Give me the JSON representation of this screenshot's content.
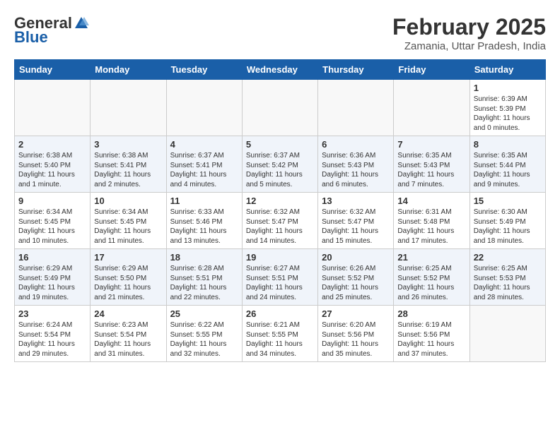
{
  "header": {
    "logo_general": "General",
    "logo_blue": "Blue",
    "title": "February 2025",
    "subtitle": "Zamania, Uttar Pradesh, India"
  },
  "days_of_week": [
    "Sunday",
    "Monday",
    "Tuesday",
    "Wednesday",
    "Thursday",
    "Friday",
    "Saturday"
  ],
  "weeks": [
    [
      {
        "day": "",
        "info": ""
      },
      {
        "day": "",
        "info": ""
      },
      {
        "day": "",
        "info": ""
      },
      {
        "day": "",
        "info": ""
      },
      {
        "day": "",
        "info": ""
      },
      {
        "day": "",
        "info": ""
      },
      {
        "day": "1",
        "info": "Sunrise: 6:39 AM\nSunset: 5:39 PM\nDaylight: 11 hours\nand 0 minutes."
      }
    ],
    [
      {
        "day": "2",
        "info": "Sunrise: 6:38 AM\nSunset: 5:40 PM\nDaylight: 11 hours\nand 1 minute."
      },
      {
        "day": "3",
        "info": "Sunrise: 6:38 AM\nSunset: 5:41 PM\nDaylight: 11 hours\nand 2 minutes."
      },
      {
        "day": "4",
        "info": "Sunrise: 6:37 AM\nSunset: 5:41 PM\nDaylight: 11 hours\nand 4 minutes."
      },
      {
        "day": "5",
        "info": "Sunrise: 6:37 AM\nSunset: 5:42 PM\nDaylight: 11 hours\nand 5 minutes."
      },
      {
        "day": "6",
        "info": "Sunrise: 6:36 AM\nSunset: 5:43 PM\nDaylight: 11 hours\nand 6 minutes."
      },
      {
        "day": "7",
        "info": "Sunrise: 6:35 AM\nSunset: 5:43 PM\nDaylight: 11 hours\nand 7 minutes."
      },
      {
        "day": "8",
        "info": "Sunrise: 6:35 AM\nSunset: 5:44 PM\nDaylight: 11 hours\nand 9 minutes."
      }
    ],
    [
      {
        "day": "9",
        "info": "Sunrise: 6:34 AM\nSunset: 5:45 PM\nDaylight: 11 hours\nand 10 minutes."
      },
      {
        "day": "10",
        "info": "Sunrise: 6:34 AM\nSunset: 5:45 PM\nDaylight: 11 hours\nand 11 minutes."
      },
      {
        "day": "11",
        "info": "Sunrise: 6:33 AM\nSunset: 5:46 PM\nDaylight: 11 hours\nand 13 minutes."
      },
      {
        "day": "12",
        "info": "Sunrise: 6:32 AM\nSunset: 5:47 PM\nDaylight: 11 hours\nand 14 minutes."
      },
      {
        "day": "13",
        "info": "Sunrise: 6:32 AM\nSunset: 5:47 PM\nDaylight: 11 hours\nand 15 minutes."
      },
      {
        "day": "14",
        "info": "Sunrise: 6:31 AM\nSunset: 5:48 PM\nDaylight: 11 hours\nand 17 minutes."
      },
      {
        "day": "15",
        "info": "Sunrise: 6:30 AM\nSunset: 5:49 PM\nDaylight: 11 hours\nand 18 minutes."
      }
    ],
    [
      {
        "day": "16",
        "info": "Sunrise: 6:29 AM\nSunset: 5:49 PM\nDaylight: 11 hours\nand 19 minutes."
      },
      {
        "day": "17",
        "info": "Sunrise: 6:29 AM\nSunset: 5:50 PM\nDaylight: 11 hours\nand 21 minutes."
      },
      {
        "day": "18",
        "info": "Sunrise: 6:28 AM\nSunset: 5:51 PM\nDaylight: 11 hours\nand 22 minutes."
      },
      {
        "day": "19",
        "info": "Sunrise: 6:27 AM\nSunset: 5:51 PM\nDaylight: 11 hours\nand 24 minutes."
      },
      {
        "day": "20",
        "info": "Sunrise: 6:26 AM\nSunset: 5:52 PM\nDaylight: 11 hours\nand 25 minutes."
      },
      {
        "day": "21",
        "info": "Sunrise: 6:25 AM\nSunset: 5:52 PM\nDaylight: 11 hours\nand 26 minutes."
      },
      {
        "day": "22",
        "info": "Sunrise: 6:25 AM\nSunset: 5:53 PM\nDaylight: 11 hours\nand 28 minutes."
      }
    ],
    [
      {
        "day": "23",
        "info": "Sunrise: 6:24 AM\nSunset: 5:54 PM\nDaylight: 11 hours\nand 29 minutes."
      },
      {
        "day": "24",
        "info": "Sunrise: 6:23 AM\nSunset: 5:54 PM\nDaylight: 11 hours\nand 31 minutes."
      },
      {
        "day": "25",
        "info": "Sunrise: 6:22 AM\nSunset: 5:55 PM\nDaylight: 11 hours\nand 32 minutes."
      },
      {
        "day": "26",
        "info": "Sunrise: 6:21 AM\nSunset: 5:55 PM\nDaylight: 11 hours\nand 34 minutes."
      },
      {
        "day": "27",
        "info": "Sunrise: 6:20 AM\nSunset: 5:56 PM\nDaylight: 11 hours\nand 35 minutes."
      },
      {
        "day": "28",
        "info": "Sunrise: 6:19 AM\nSunset: 5:56 PM\nDaylight: 11 hours\nand 37 minutes."
      },
      {
        "day": "",
        "info": ""
      }
    ]
  ]
}
